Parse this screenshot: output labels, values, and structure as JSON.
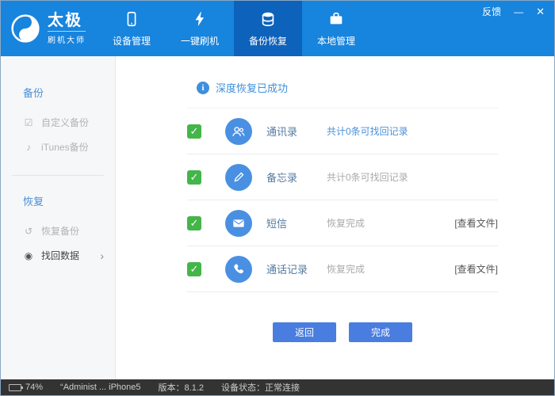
{
  "colors": {
    "header_blue": "#1784de",
    "active_tab_blue": "#0d62bb",
    "accent_blue": "#4a90d9",
    "checkbox_green": "#44b549",
    "button_blue": "#4a7de0"
  },
  "header": {
    "logo_title": "太极",
    "logo_subtitle": "刷机大师",
    "tabs": [
      {
        "label": "设备管理",
        "icon": "device-icon"
      },
      {
        "label": "一键刷机",
        "icon": "flash-icon"
      },
      {
        "label": "备份恢复",
        "icon": "database-icon",
        "active": true
      },
      {
        "label": "本地管理",
        "icon": "briefcase-icon"
      }
    ],
    "feedback": "反馈",
    "minimize": "—",
    "close": "✕"
  },
  "sidebar": {
    "backup_title": "备份",
    "backup_items": [
      {
        "label": "自定义备份",
        "icon": "☑",
        "icon_name": "checkbox-square-icon"
      },
      {
        "label": "iTunes备份",
        "icon": "♪",
        "icon_name": "music-note-icon"
      }
    ],
    "restore_title": "恢复",
    "restore_items": [
      {
        "label": "恢复备份",
        "icon": "↺",
        "icon_name": "restore-arrow-icon"
      },
      {
        "label": "找回数据",
        "icon": "◉",
        "icon_name": "target-icon",
        "active": true
      }
    ],
    "chevron": "›"
  },
  "main": {
    "banner": "深度恢复已成功",
    "info_glyph": "i",
    "checkbox_glyph": "✓",
    "rows": [
      {
        "label": "通讯录",
        "status": "共计0条可找回记录",
        "link": "",
        "icon_name": "contacts-icon"
      },
      {
        "label": "备忘录",
        "status": "共计0条可找回记录",
        "link": "",
        "icon_name": "memo-pencil-icon"
      },
      {
        "label": "短信",
        "status": "恢复完成",
        "link": "[查看文件]",
        "icon_name": "sms-envelope-icon"
      },
      {
        "label": "通话记录",
        "status": "恢复完成",
        "link": "[查看文件]",
        "icon_name": "phone-call-icon"
      }
    ],
    "back_button": "返回",
    "done_button": "完成"
  },
  "statusbar": {
    "battery_percent": "74%",
    "device_name": "“Administ ... iPhone5",
    "version": "版本：8.1.2",
    "connection": "设备状态：正常连接"
  }
}
